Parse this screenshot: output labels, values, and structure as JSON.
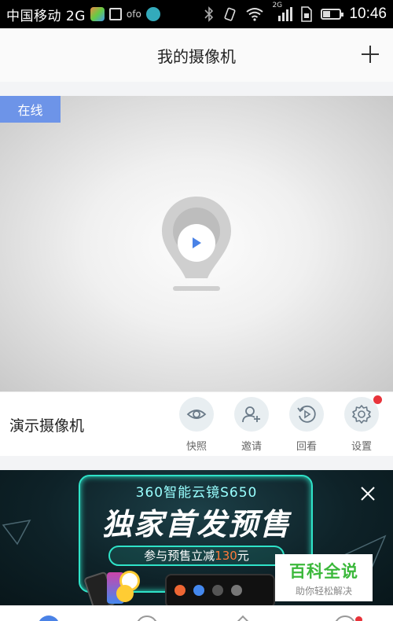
{
  "status_bar": {
    "carrier": "中国移动 2G",
    "app_notif_text": "ofo",
    "network_tag": "2G",
    "time": "10:46",
    "icons": [
      "alipay-app-icon",
      "gallery-icon",
      "ofo-icon",
      "chinamobile-icon",
      "bluetooth-icon",
      "vibrate-icon",
      "wifi-icon",
      "signal-icon",
      "sim-icon",
      "battery-icon"
    ]
  },
  "header": {
    "title": "我的摄像机",
    "add_icon": "plus-icon"
  },
  "camera": {
    "status_badge": "在线",
    "name": "演示摄像机",
    "play_icon": "play-icon",
    "placeholder_icon": "camera-placeholder-icon",
    "actions": [
      {
        "label": "快照",
        "icon": "eye-icon"
      },
      {
        "label": "邀请",
        "icon": "add-user-icon"
      },
      {
        "label": "回看",
        "icon": "playback-icon"
      },
      {
        "label": "设置",
        "icon": "gear-icon",
        "has_notification": true
      }
    ]
  },
  "ad": {
    "product": "360智能云镜S650",
    "headline": "独家首发预售",
    "offer_prefix": "参与预售立减",
    "offer_amount": "130",
    "offer_suffix": "元",
    "close_icon": "close-icon"
  },
  "watermark": {
    "main": "百科全说",
    "sub": "助你轻松解决"
  },
  "bottom_nav": {
    "items": [
      "home-icon",
      "discover-icon",
      "shop-icon",
      "profile-icon"
    ],
    "profile_has_notification": true
  },
  "colors": {
    "online_badge": "#6d94e8",
    "accent_blue": "#4a82e6",
    "notification_red": "#e8333a",
    "ad_neon": "#2fe3c8",
    "watermark_green": "#3bb83b"
  }
}
